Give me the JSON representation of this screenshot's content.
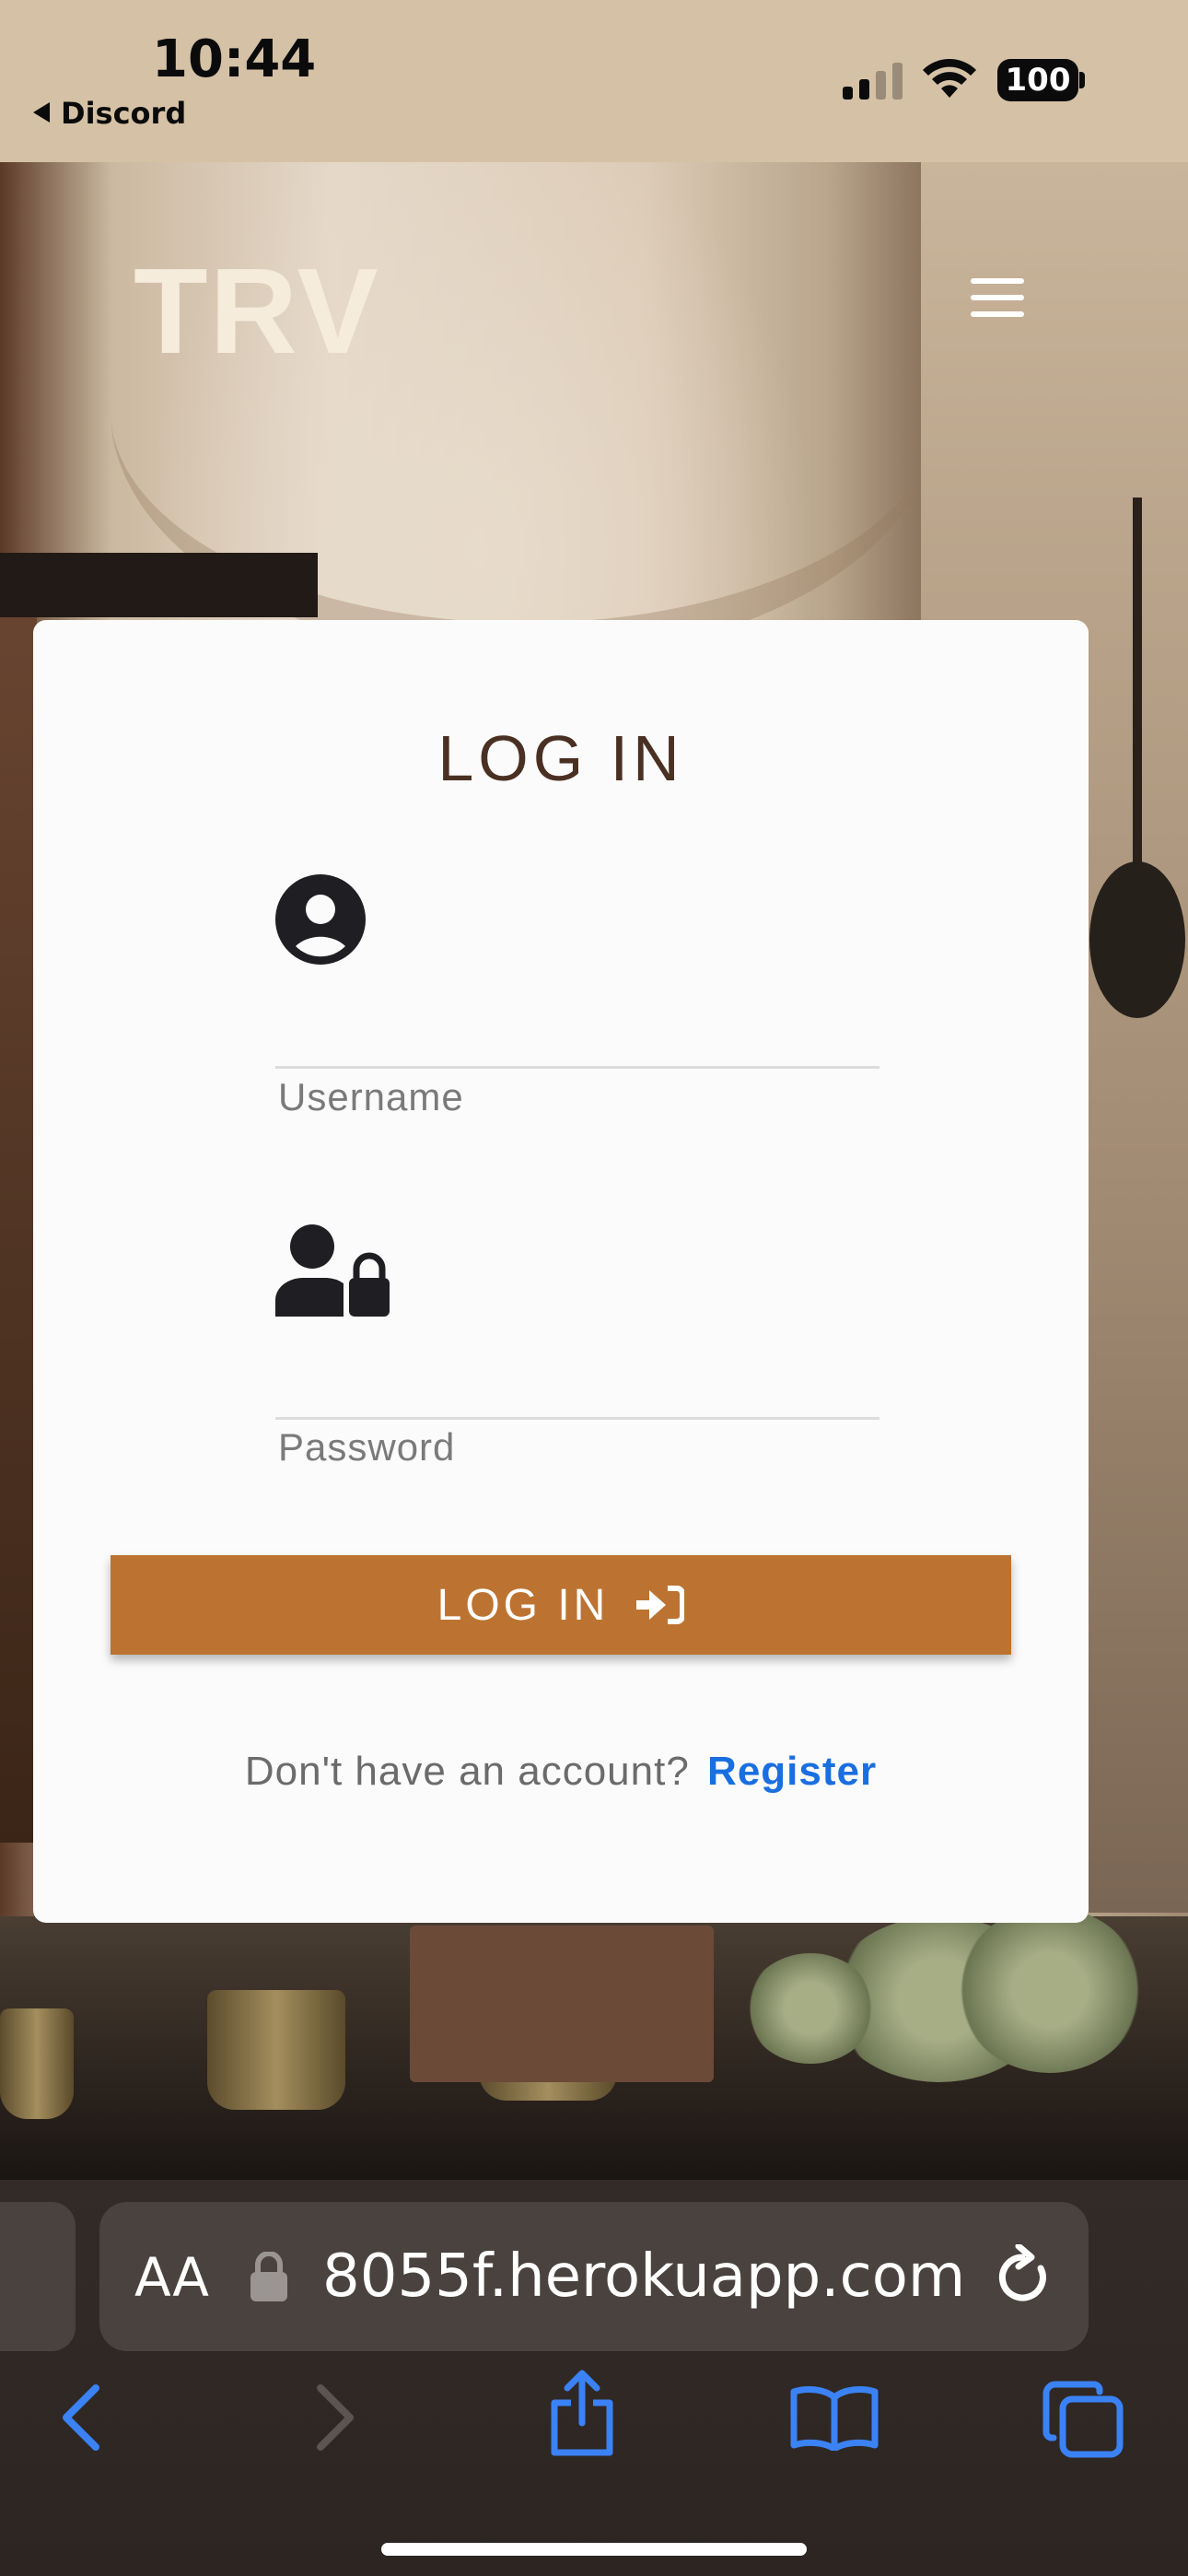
{
  "status_bar": {
    "time": "10:44",
    "back_app": "Discord",
    "battery": "100"
  },
  "header": {
    "brand": "TRV"
  },
  "login_card": {
    "title": "LOG IN",
    "username_label": "Username",
    "password_label": "Password",
    "button_label": "LOG IN",
    "register_prompt": "Don't have an account?",
    "register_link": "Register"
  },
  "browser": {
    "text_size_label": "AA",
    "url": "8055f.herokuapp.com"
  },
  "colors": {
    "accent_button": "#bc7331",
    "link": "#1a6fe0",
    "title": "#4a3022",
    "status_bar_bg": "#d5c1a5"
  }
}
